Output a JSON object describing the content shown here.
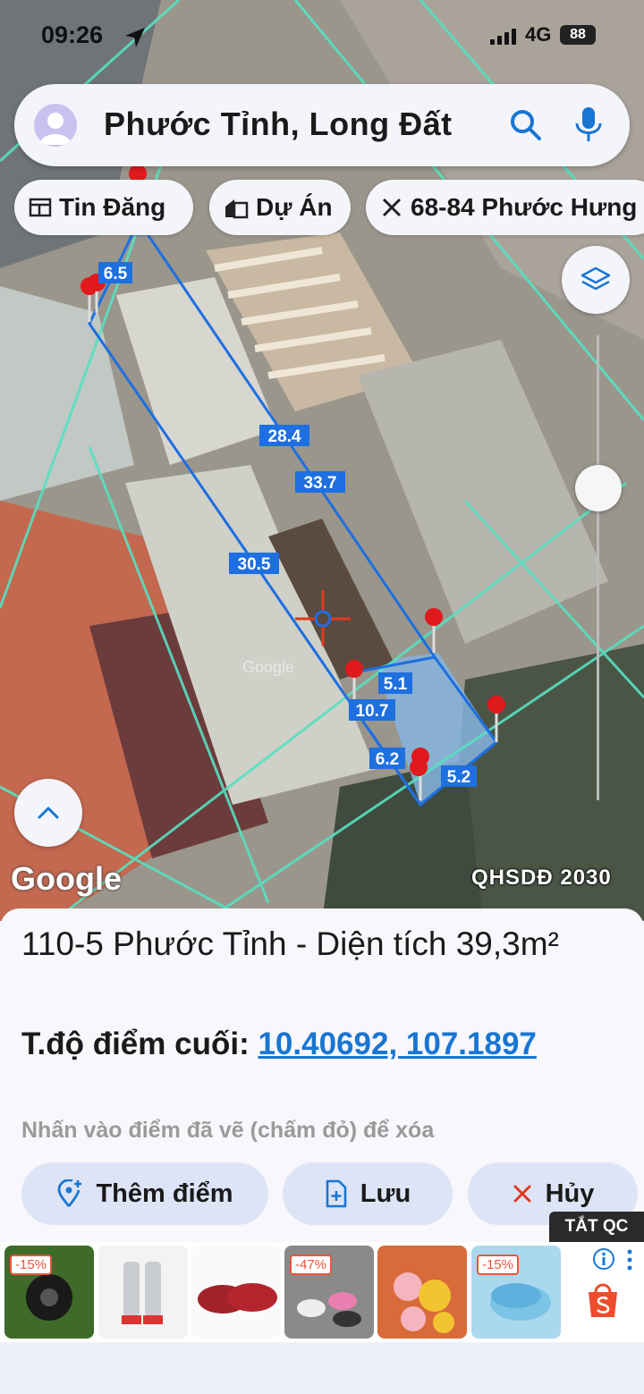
{
  "status_bar": {
    "time": "09:26",
    "network": "4G",
    "battery": "88"
  },
  "search": {
    "query": "Phước Tỉnh, Long Đất"
  },
  "chips": [
    {
      "label": "Tin Đăng",
      "icon": "listing-icon"
    },
    {
      "label": "Dự Án",
      "icon": "building-icon"
    },
    {
      "label": "68-84 Phước Hưng",
      "icon": "ruler-icon"
    }
  ],
  "map": {
    "google_label": "Google",
    "layer_label": "QHSDĐ 2030",
    "watermark": "Google",
    "measurements": [
      "6.5",
      "28.4",
      "33.7",
      "30.5",
      "5.1",
      "10.7",
      "6.2",
      "5.2"
    ]
  },
  "info": {
    "title": "110-5 Phước Tỉnh - Diện tích 39,3m²",
    "coord_label": "T.độ điểm cuối:",
    "coord_value": "10.40692, 107.1897",
    "hint": "Nhấn vào điểm đã vẽ (chấm đỏ) để xóa"
  },
  "actions": {
    "add_point": "Thêm điểm",
    "save": "Lưu",
    "cancel": "Hủy"
  },
  "ad": {
    "close_label": "TẮT QC",
    "items": [
      {
        "name": "ad-item-1",
        "badge": "-15%"
      },
      {
        "name": "ad-item-2",
        "badge": ""
      },
      {
        "name": "ad-item-3",
        "badge": ""
      },
      {
        "name": "ad-item-4",
        "badge": "-47%"
      },
      {
        "name": "ad-item-5",
        "badge": ""
      },
      {
        "name": "ad-item-6",
        "badge": "-15%"
      }
    ]
  },
  "colors": {
    "accent": "#1976d2",
    "outline": "#1e6fe0",
    "pin": "#e0191d",
    "label_bg": "#1e6fe0"
  }
}
